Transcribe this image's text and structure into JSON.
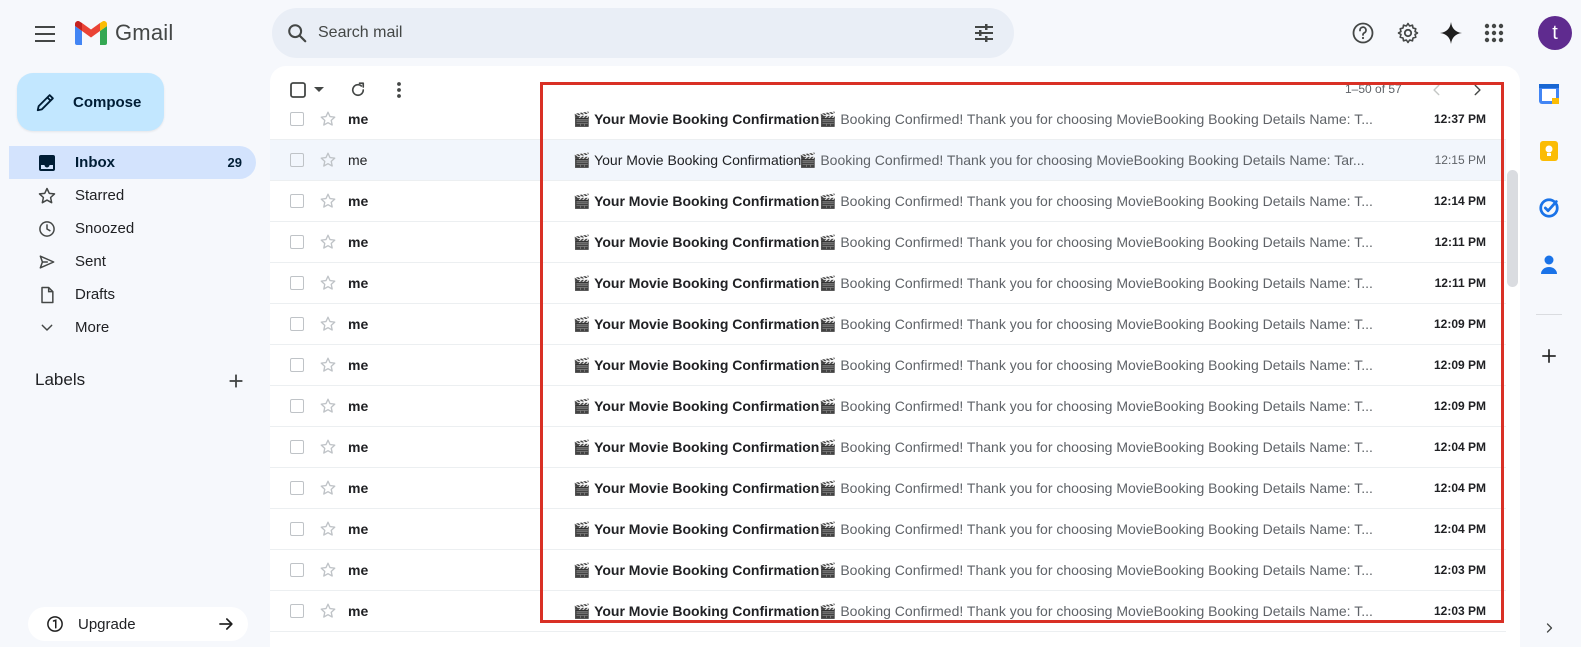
{
  "app": {
    "name": "Gmail"
  },
  "search": {
    "placeholder": "Search mail"
  },
  "sidebar": {
    "compose_label": "Compose",
    "items": [
      {
        "label": "Inbox",
        "count": "29",
        "icon": "inbox-icon",
        "active": true
      },
      {
        "label": "Starred",
        "icon": "star-icon"
      },
      {
        "label": "Snoozed",
        "icon": "clock-icon"
      },
      {
        "label": "Sent",
        "icon": "send-icon"
      },
      {
        "label": "Drafts",
        "icon": "draft-icon"
      },
      {
        "label": "More",
        "icon": "chevron-down-icon"
      }
    ],
    "labels_heading": "Labels",
    "upgrade_label": "Upgrade"
  },
  "user": {
    "initial": "t",
    "avatar_color": "#5f2b8f"
  },
  "toolbar": {
    "pager": "1–50 of 57"
  },
  "emails": [
    {
      "sender": "me",
      "subject": "🎬 Your Movie Booking Confirmation",
      "snippet": "🎬 Booking Confirmed! Thank you for choosing MovieBooking Booking Details Name: T...",
      "time": "12:37 PM",
      "read": false
    },
    {
      "sender": "me",
      "subject": "🎬 Your Movie Booking Confirmation",
      "snippet": "🎬 Booking Confirmed! Thank you for choosing MovieBooking Booking Details Name: Tar...",
      "time": "12:15 PM",
      "read": true
    },
    {
      "sender": "me",
      "subject": "🎬 Your Movie Booking Confirmation",
      "snippet": "🎬 Booking Confirmed! Thank you for choosing MovieBooking Booking Details Name: T...",
      "time": "12:14 PM",
      "read": false
    },
    {
      "sender": "me",
      "subject": "🎬 Your Movie Booking Confirmation",
      "snippet": "🎬 Booking Confirmed! Thank you for choosing MovieBooking Booking Details Name: T...",
      "time": "12:11 PM",
      "read": false
    },
    {
      "sender": "me",
      "subject": "🎬 Your Movie Booking Confirmation",
      "snippet": "🎬 Booking Confirmed! Thank you for choosing MovieBooking Booking Details Name: T...",
      "time": "12:11 PM",
      "read": false
    },
    {
      "sender": "me",
      "subject": "🎬 Your Movie Booking Confirmation",
      "snippet": "🎬 Booking Confirmed! Thank you for choosing MovieBooking Booking Details Name: T...",
      "time": "12:09 PM",
      "read": false
    },
    {
      "sender": "me",
      "subject": "🎬 Your Movie Booking Confirmation",
      "snippet": "🎬 Booking Confirmed! Thank you for choosing MovieBooking Booking Details Name: T...",
      "time": "12:09 PM",
      "read": false
    },
    {
      "sender": "me",
      "subject": "🎬 Your Movie Booking Confirmation",
      "snippet": "🎬 Booking Confirmed! Thank you for choosing MovieBooking Booking Details Name: T...",
      "time": "12:09 PM",
      "read": false
    },
    {
      "sender": "me",
      "subject": "🎬 Your Movie Booking Confirmation",
      "snippet": "🎬 Booking Confirmed! Thank you for choosing MovieBooking Booking Details Name: T...",
      "time": "12:04 PM",
      "read": false
    },
    {
      "sender": "me",
      "subject": "🎬 Your Movie Booking Confirmation",
      "snippet": "🎬 Booking Confirmed! Thank you for choosing MovieBooking Booking Details Name: T...",
      "time": "12:04 PM",
      "read": false
    },
    {
      "sender": "me",
      "subject": "🎬 Your Movie Booking Confirmation",
      "snippet": "🎬 Booking Confirmed! Thank you for choosing MovieBooking Booking Details Name: T...",
      "time": "12:04 PM",
      "read": false
    },
    {
      "sender": "me",
      "subject": "🎬 Your Movie Booking Confirmation",
      "snippet": "🎬 Booking Confirmed! Thank you for choosing MovieBooking Booking Details Name: T...",
      "time": "12:03 PM",
      "read": false
    },
    {
      "sender": "me",
      "subject": "🎬 Your Movie Booking Confirmation",
      "snippet": "🎬 Booking Confirmed! Thank you for choosing MovieBooking Booking Details Name: T...",
      "time": "12:03 PM",
      "read": false
    }
  ],
  "colors": {
    "accent": "#c2e7ff",
    "active_nav": "#d3e3fd",
    "highlight": "#d93025"
  }
}
